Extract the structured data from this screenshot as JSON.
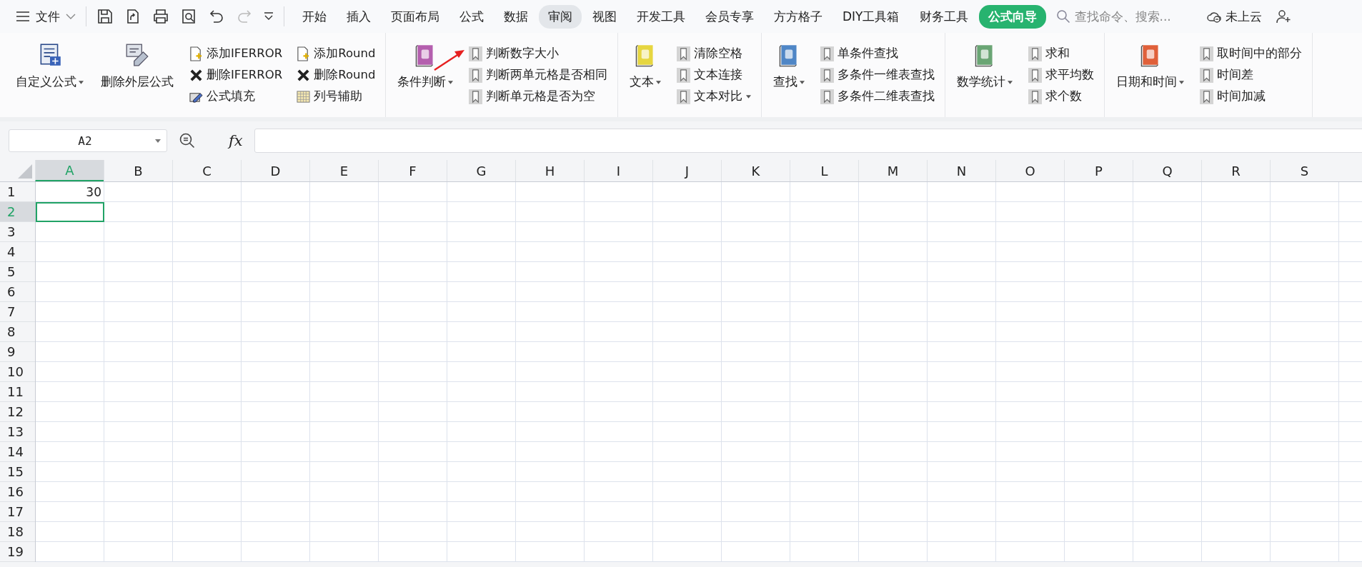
{
  "menu": {
    "label": "文件"
  },
  "tabs": [
    {
      "label": "开始",
      "selected": false,
      "highlighted": false
    },
    {
      "label": "插入",
      "selected": false,
      "highlighted": false
    },
    {
      "label": "页面布局",
      "selected": false,
      "highlighted": false
    },
    {
      "label": "公式",
      "selected": false,
      "highlighted": false
    },
    {
      "label": "数据",
      "selected": false,
      "highlighted": false
    },
    {
      "label": "审阅",
      "selected": false,
      "highlighted": true
    },
    {
      "label": "视图",
      "selected": false,
      "highlighted": false
    },
    {
      "label": "开发工具",
      "selected": false,
      "highlighted": false
    },
    {
      "label": "会员专享",
      "selected": false,
      "highlighted": false
    },
    {
      "label": "方方格子",
      "selected": false,
      "highlighted": false
    },
    {
      "label": "DIY工具箱",
      "selected": false,
      "highlighted": false
    },
    {
      "label": "财务工具",
      "selected": false,
      "highlighted": false
    },
    {
      "label": "公式向导",
      "selected": true,
      "highlighted": false
    }
  ],
  "search": {
    "placeholder": "查找命令、搜索..."
  },
  "cloud": {
    "label": "未上云"
  },
  "ribbon": {
    "groups": [
      {
        "buttons": [
          {
            "label": "自定义公式",
            "kind": "formula",
            "dropdown": true
          },
          {
            "label": "删除外层公式",
            "kind": "eraser",
            "dropdown": false
          }
        ],
        "columns": [
          [
            {
              "label": "添加IFERROR",
              "kind": "add",
              "dropdown": false
            },
            {
              "label": "删除IFERROR",
              "kind": "delete",
              "dropdown": false
            },
            {
              "label": "公式填充",
              "kind": "fill",
              "dropdown": false
            }
          ],
          [
            {
              "label": "添加Round",
              "kind": "add",
              "dropdown": false
            },
            {
              "label": "删除Round",
              "kind": "delete",
              "dropdown": false
            },
            {
              "label": "列号辅助",
              "kind": "grid",
              "dropdown": false
            }
          ]
        ]
      },
      {
        "buttons": [
          {
            "label": "条件判断",
            "kind": "book",
            "color": "#b45fae",
            "dropdown": true
          }
        ],
        "columns": [
          [
            {
              "label": "判断数字大小",
              "kind": "bookmark",
              "dropdown": false
            },
            {
              "label": "判断两单元格是否相同",
              "kind": "bookmark",
              "dropdown": false
            },
            {
              "label": "判断单元格是否为空",
              "kind": "bookmark",
              "dropdown": false
            }
          ]
        ]
      },
      {
        "buttons": [
          {
            "label": "文本",
            "kind": "book",
            "color": "#e6d640",
            "dropdown": true
          }
        ],
        "columns": [
          [
            {
              "label": "清除空格",
              "kind": "bookmark",
              "dropdown": false
            },
            {
              "label": "文本连接",
              "kind": "bookmark",
              "dropdown": false
            },
            {
              "label": "文本对比",
              "kind": "bookmark",
              "dropdown": true
            }
          ]
        ]
      },
      {
        "buttons": [
          {
            "label": "查找",
            "kind": "book",
            "color": "#4f86c6",
            "dropdown": true
          }
        ],
        "columns": [
          [
            {
              "label": "单条件查找",
              "kind": "bookmark",
              "dropdown": false
            },
            {
              "label": "多条件一维表查找",
              "kind": "bookmark",
              "dropdown": false
            },
            {
              "label": "多条件二维表查找",
              "kind": "bookmark",
              "dropdown": false
            }
          ]
        ]
      },
      {
        "buttons": [
          {
            "label": "数学统计",
            "kind": "book",
            "color": "#6aa574",
            "dropdown": true
          }
        ],
        "columns": [
          [
            {
              "label": "求和",
              "kind": "bookmark",
              "dropdown": false
            },
            {
              "label": "求平均数",
              "kind": "bookmark",
              "dropdown": false
            },
            {
              "label": "求个数",
              "kind": "bookmark",
              "dropdown": false
            }
          ]
        ]
      },
      {
        "buttons": [
          {
            "label": "日期和时间",
            "kind": "book",
            "color": "#e0603a",
            "dropdown": true
          }
        ],
        "columns": [
          [
            {
              "label": "取时间中的部分",
              "kind": "bookmark",
              "dropdown": false
            },
            {
              "label": "时间差",
              "kind": "bookmark",
              "dropdown": false
            },
            {
              "label": "时间加减",
              "kind": "bookmark",
              "dropdown": false
            }
          ]
        ]
      }
    ]
  },
  "formula_bar": {
    "name_box": "A2",
    "fx": "fx"
  },
  "sheet": {
    "columns": [
      {
        "label": "A",
        "selected": true
      },
      {
        "label": "B",
        "selected": false
      },
      {
        "label": "C",
        "selected": false
      },
      {
        "label": "D",
        "selected": false
      },
      {
        "label": "E",
        "selected": false
      },
      {
        "label": "F",
        "selected": false
      },
      {
        "label": "G",
        "selected": false
      },
      {
        "label": "H",
        "selected": false
      },
      {
        "label": "I",
        "selected": false
      },
      {
        "label": "J",
        "selected": false
      },
      {
        "label": "K",
        "selected": false
      },
      {
        "label": "L",
        "selected": false
      },
      {
        "label": "M",
        "selected": false
      },
      {
        "label": "N",
        "selected": false
      },
      {
        "label": "O",
        "selected": false
      },
      {
        "label": "P",
        "selected": false
      },
      {
        "label": "Q",
        "selected": false
      },
      {
        "label": "R",
        "selected": false
      },
      {
        "label": "S",
        "selected": false
      }
    ],
    "rows": [
      {
        "label": "1",
        "selected": false,
        "cells": [
          "30"
        ]
      },
      {
        "label": "2",
        "selected": true
      },
      {
        "label": "3",
        "selected": false
      },
      {
        "label": "4",
        "selected": false
      },
      {
        "label": "5",
        "selected": false
      },
      {
        "label": "6",
        "selected": false
      },
      {
        "label": "7",
        "selected": false
      },
      {
        "label": "8",
        "selected": false
      },
      {
        "label": "9",
        "selected": false
      },
      {
        "label": "10",
        "selected": false
      },
      {
        "label": "11",
        "selected": false
      },
      {
        "label": "12",
        "selected": false
      },
      {
        "label": "13",
        "selected": false
      },
      {
        "label": "14",
        "selected": false
      },
      {
        "label": "15",
        "selected": false
      },
      {
        "label": "16",
        "selected": false
      },
      {
        "label": "17",
        "selected": false
      },
      {
        "label": "18",
        "selected": false
      },
      {
        "label": "19",
        "selected": false
      }
    ]
  }
}
